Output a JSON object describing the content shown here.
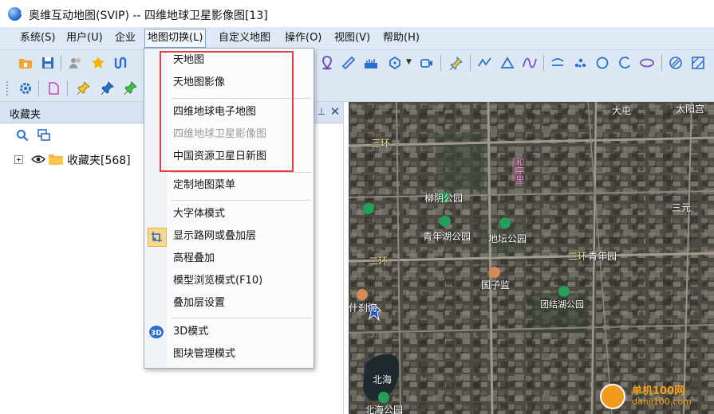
{
  "window": {
    "title": "奥维互动地图(SVIP) -- 四维地球卫星影像图[13]",
    "app_icon": "globe-app-icon"
  },
  "menubar": {
    "items": [
      "系统(S)",
      "用户(U)",
      "企业",
      "地图切换(L)",
      "自定义地图",
      "操作(O)",
      "视图(V)",
      "帮助(H)"
    ],
    "active": "地图切换(L)"
  },
  "map_switch_menu": {
    "items": [
      {
        "label": "天地图",
        "enabled": true
      },
      {
        "label": "天地图影像",
        "enabled": true
      },
      {
        "label": "四维地球电子地图",
        "enabled": true
      },
      {
        "label": "四维地球卫星影像图",
        "enabled": false
      },
      {
        "label": "中国资源卫星日新图",
        "enabled": true
      },
      {
        "label": "定制地图菜单",
        "enabled": true
      },
      {
        "label": "大字体模式",
        "enabled": true
      },
      {
        "label": "显示路网或叠加层",
        "enabled": true,
        "checked": true
      },
      {
        "label": "高程叠加",
        "enabled": true
      },
      {
        "label": "模型浏览模式(F10)",
        "enabled": true
      },
      {
        "label": "叠加层设置",
        "enabled": true
      },
      {
        "label": "3D模式",
        "enabled": true,
        "icon": "3d-icon"
      },
      {
        "label": "图块管理模式",
        "enabled": true
      }
    ],
    "highlight_color": "#e53c3c"
  },
  "favorites_panel": {
    "title": "收藏夹",
    "tree_root": "收藏夹[568]"
  },
  "map": {
    "labels": [
      {
        "text": "三环",
        "color": "#f0e6a0"
      },
      {
        "text": "二环",
        "color": "#f0e6a0"
      },
      {
        "text": "二环",
        "color": "#f0e6a0"
      },
      {
        "text": "北海",
        "color": "#ffffff"
      },
      {
        "text": "北海公园",
        "color": "#ffffff"
      },
      {
        "text": "柳阴公园",
        "color": "#ffffff"
      },
      {
        "text": "青年湖公园",
        "color": "#ffffff"
      },
      {
        "text": "地坛公园",
        "color": "#ffffff"
      },
      {
        "text": "国子监",
        "color": "#ffffff"
      },
      {
        "text": "青年园",
        "color": "#ffffff"
      },
      {
        "text": "和平里",
        "color": "#f29ad8"
      },
      {
        "text": "三元",
        "color": "#ffffff"
      },
      {
        "text": "大屯",
        "color": "#ffffff"
      },
      {
        "text": "太阳宫",
        "color": "#ffffff"
      },
      {
        "text": "团结湖公园",
        "color": "#ffffff"
      },
      {
        "text": "什刹海",
        "color": "#ffffff"
      }
    ]
  },
  "watermark": {
    "line1": "单机100网",
    "line2": "danji100.com"
  },
  "colors": {
    "menubar_bg": "#dfe9f5",
    "toolbar_bg": "#dde8f5",
    "accent": "#2a6fd0"
  }
}
